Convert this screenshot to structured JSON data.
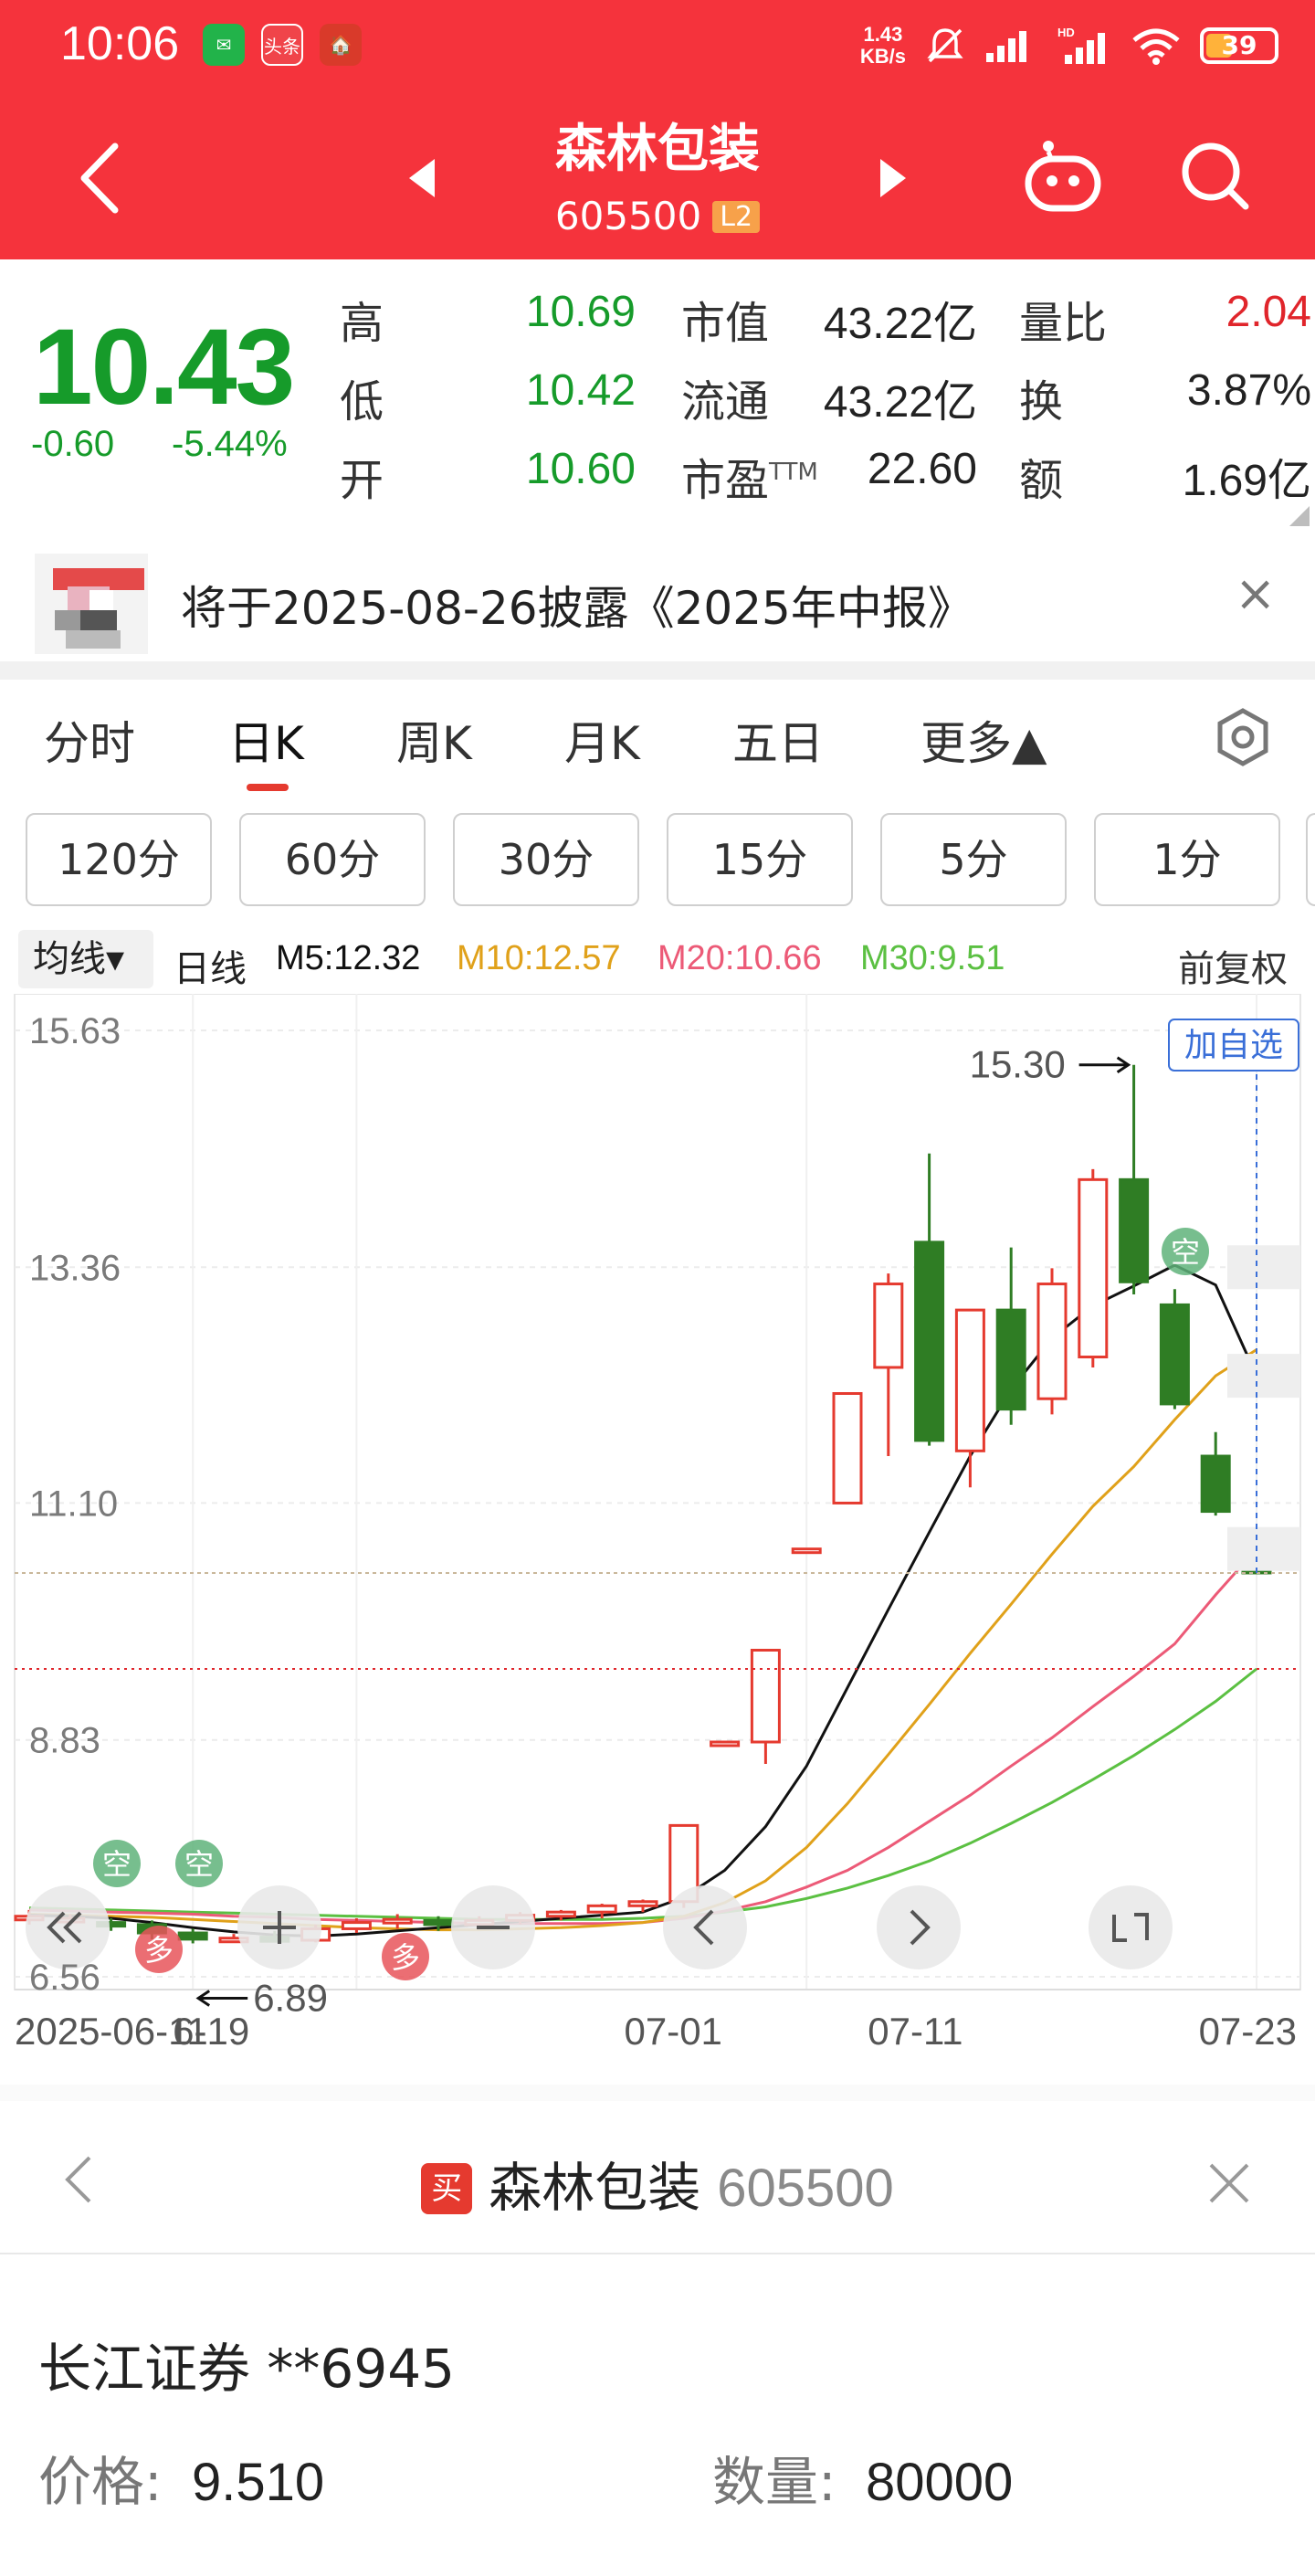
{
  "status_bar": {
    "time": "10:06",
    "net_speed_value": "1.43",
    "net_speed_unit": "KB/s",
    "battery": "39",
    "battery_level": 0.39,
    "app_icons": [
      "wechat-icon",
      "toutiao-icon",
      "red-app-icon"
    ],
    "toutiao_label": "头条"
  },
  "header": {
    "stock_name": "森林包装",
    "stock_code": "605500",
    "level_badge": "L2"
  },
  "quote": {
    "price": "10.43",
    "change": "-0.60",
    "change_pct": "-5.44%",
    "fields": [
      {
        "label": "高",
        "value": "10.69"
      },
      {
        "label": "低",
        "value": "10.42"
      },
      {
        "label": "开",
        "value": "10.60"
      },
      {
        "label": "市值",
        "value": "43.22亿"
      },
      {
        "label": "流通",
        "value": "43.22亿"
      },
      {
        "label": "市盈TTM",
        "value": "22.60"
      },
      {
        "label": "量比",
        "value": "2.04"
      },
      {
        "label": "换",
        "value": "3.87%"
      },
      {
        "label": "额",
        "value": "1.69亿"
      }
    ],
    "pe_label": "市盈",
    "pe_superscript": "TTM"
  },
  "notice": {
    "text": "将于2025-08-26披露《2025年中报》",
    "close": "×"
  },
  "tabs": [
    "分时",
    "日K",
    "周K",
    "月K",
    "五日",
    "更多▲"
  ],
  "active_tab": "日K",
  "periods": [
    "120分",
    "60分",
    "30分",
    "15分",
    "5分",
    "1分"
  ],
  "ma_bar": {
    "selector": "均线▾",
    "line_type": "日线",
    "ma5": "M5:12.32",
    "ma10": "M10:12.57",
    "ma20": "M20:10.66",
    "ma30": "M30:9.51",
    "adjust": "前复权",
    "colors": {
      "ma5": "#111111",
      "ma10": "#e0a11a",
      "ma20": "#ec5a77",
      "ma30": "#5bc042"
    }
  },
  "chart_labels": {
    "y_ticks": [
      "15.63",
      "13.36",
      "11.10",
      "8.83",
      "6.56"
    ],
    "x_ticks": [
      "2025-06-11",
      "6-19",
      "07-01",
      "07-11",
      "07-23"
    ],
    "high_label": "15.30",
    "low_label": "6.89",
    "add_watch": "加自选",
    "tag_short": "空",
    "tag_long": "多"
  },
  "chart_data": {
    "type": "candlestick",
    "y_range": [
      6.56,
      15.63
    ],
    "candles": [
      {
        "o": 7.12,
        "c": 7.14,
        "h": 7.2,
        "l": 7.06
      },
      {
        "o": 7.1,
        "c": 7.12,
        "h": 7.16,
        "l": 7.05
      },
      {
        "o": 7.08,
        "c": 7.06,
        "h": 7.12,
        "l": 7.0
      },
      {
        "o": 7.06,
        "c": 6.98,
        "h": 7.1,
        "l": 6.92
      },
      {
        "o": 6.98,
        "c": 6.92,
        "h": 7.02,
        "l": 6.88
      },
      {
        "o": 6.9,
        "c": 6.93,
        "h": 6.97,
        "l": 6.89
      },
      {
        "o": 6.94,
        "c": 6.9,
        "h": 7.0,
        "l": 6.89
      },
      {
        "o": 6.91,
        "c": 7.02,
        "h": 7.06,
        "l": 6.89
      },
      {
        "o": 7.02,
        "c": 7.08,
        "h": 7.12,
        "l": 6.98
      },
      {
        "o": 7.08,
        "c": 7.11,
        "h": 7.16,
        "l": 7.02
      },
      {
        "o": 7.1,
        "c": 7.06,
        "h": 7.14,
        "l": 7.0
      },
      {
        "o": 7.06,
        "c": 7.1,
        "h": 7.14,
        "l": 7.02
      },
      {
        "o": 7.1,
        "c": 7.15,
        "h": 7.18,
        "l": 7.06
      },
      {
        "o": 7.14,
        "c": 7.18,
        "h": 7.2,
        "l": 7.1
      },
      {
        "o": 7.18,
        "c": 7.24,
        "h": 7.26,
        "l": 7.12
      },
      {
        "o": 7.24,
        "c": 7.28,
        "h": 7.3,
        "l": 7.18
      },
      {
        "o": 7.28,
        "c": 8.01,
        "h": 8.01,
        "l": 7.22
      },
      {
        "o": 8.81,
        "c": 8.81,
        "h": 8.81,
        "l": 8.81
      },
      {
        "o": 8.81,
        "c": 9.69,
        "h": 9.69,
        "l": 8.6
      },
      {
        "o": 10.66,
        "c": 10.66,
        "h": 10.66,
        "l": 10.66
      },
      {
        "o": 11.1,
        "c": 12.15,
        "h": 12.15,
        "l": 11.1
      },
      {
        "o": 12.4,
        "c": 13.2,
        "h": 13.3,
        "l": 11.55
      },
      {
        "o": 13.6,
        "c": 11.7,
        "h": 14.45,
        "l": 11.65
      },
      {
        "o": 11.6,
        "c": 12.95,
        "h": 12.95,
        "l": 11.25
      },
      {
        "o": 12.95,
        "c": 12.0,
        "h": 13.55,
        "l": 11.85
      },
      {
        "o": 12.1,
        "c": 13.2,
        "h": 13.35,
        "l": 11.95
      },
      {
        "o": 12.5,
        "c": 14.2,
        "h": 14.3,
        "l": 12.4
      },
      {
        "o": 14.2,
        "c": 13.22,
        "h": 15.3,
        "l": 13.1
      },
      {
        "o": 13.0,
        "c": 12.05,
        "h": 13.15,
        "l": 12.0
      },
      {
        "o": 11.55,
        "c": 11.02,
        "h": 11.78,
        "l": 10.98
      },
      {
        "o": 10.6,
        "c": 10.43,
        "h": 10.69,
        "l": 10.42
      }
    ],
    "ma5": [
      7.15,
      7.14,
      7.12,
      7.08,
      7.03,
      6.99,
      6.96,
      6.95,
      6.97,
      7.0,
      7.03,
      7.06,
      7.09,
      7.12,
      7.15,
      7.18,
      7.32,
      7.58,
      8.0,
      8.58,
      9.33,
      10.08,
      10.82,
      11.55,
      12.19,
      12.68,
      12.99,
      13.18,
      13.38,
      13.19,
      12.32
    ],
    "ma10": [
      7.16,
      7.15,
      7.14,
      7.13,
      7.11,
      7.09,
      7.07,
      7.05,
      7.03,
      7.02,
      7.01,
      7.01,
      7.02,
      7.03,
      7.05,
      7.08,
      7.14,
      7.27,
      7.48,
      7.8,
      8.22,
      8.69,
      9.17,
      9.66,
      10.13,
      10.61,
      11.07,
      11.45,
      11.9,
      12.32,
      12.57
    ],
    "ma20": [
      7.2,
      7.19,
      7.18,
      7.17,
      7.16,
      7.14,
      7.13,
      7.11,
      7.1,
      7.09,
      7.08,
      7.07,
      7.07,
      7.07,
      7.07,
      7.08,
      7.12,
      7.19,
      7.28,
      7.42,
      7.58,
      7.8,
      8.05,
      8.3,
      8.58,
      8.85,
      9.15,
      9.44,
      9.75,
      10.22,
      10.66
    ],
    "ma30": [
      7.22,
      7.21,
      7.2,
      7.19,
      7.18,
      7.17,
      7.16,
      7.15,
      7.14,
      7.13,
      7.12,
      7.11,
      7.11,
      7.11,
      7.11,
      7.12,
      7.14,
      7.18,
      7.23,
      7.31,
      7.41,
      7.53,
      7.67,
      7.84,
      8.03,
      8.23,
      8.45,
      8.68,
      8.93,
      9.2,
      9.51
    ],
    "colors": {
      "up": "#e53a2f",
      "down": "#2f7d24"
    }
  },
  "order": {
    "title": "森林包装",
    "code": "605500",
    "badge": "买",
    "broker": "长江证券 **6945",
    "price_label": "价格:",
    "price": "9.510",
    "qty_label": "数量:",
    "qty": "80000"
  }
}
